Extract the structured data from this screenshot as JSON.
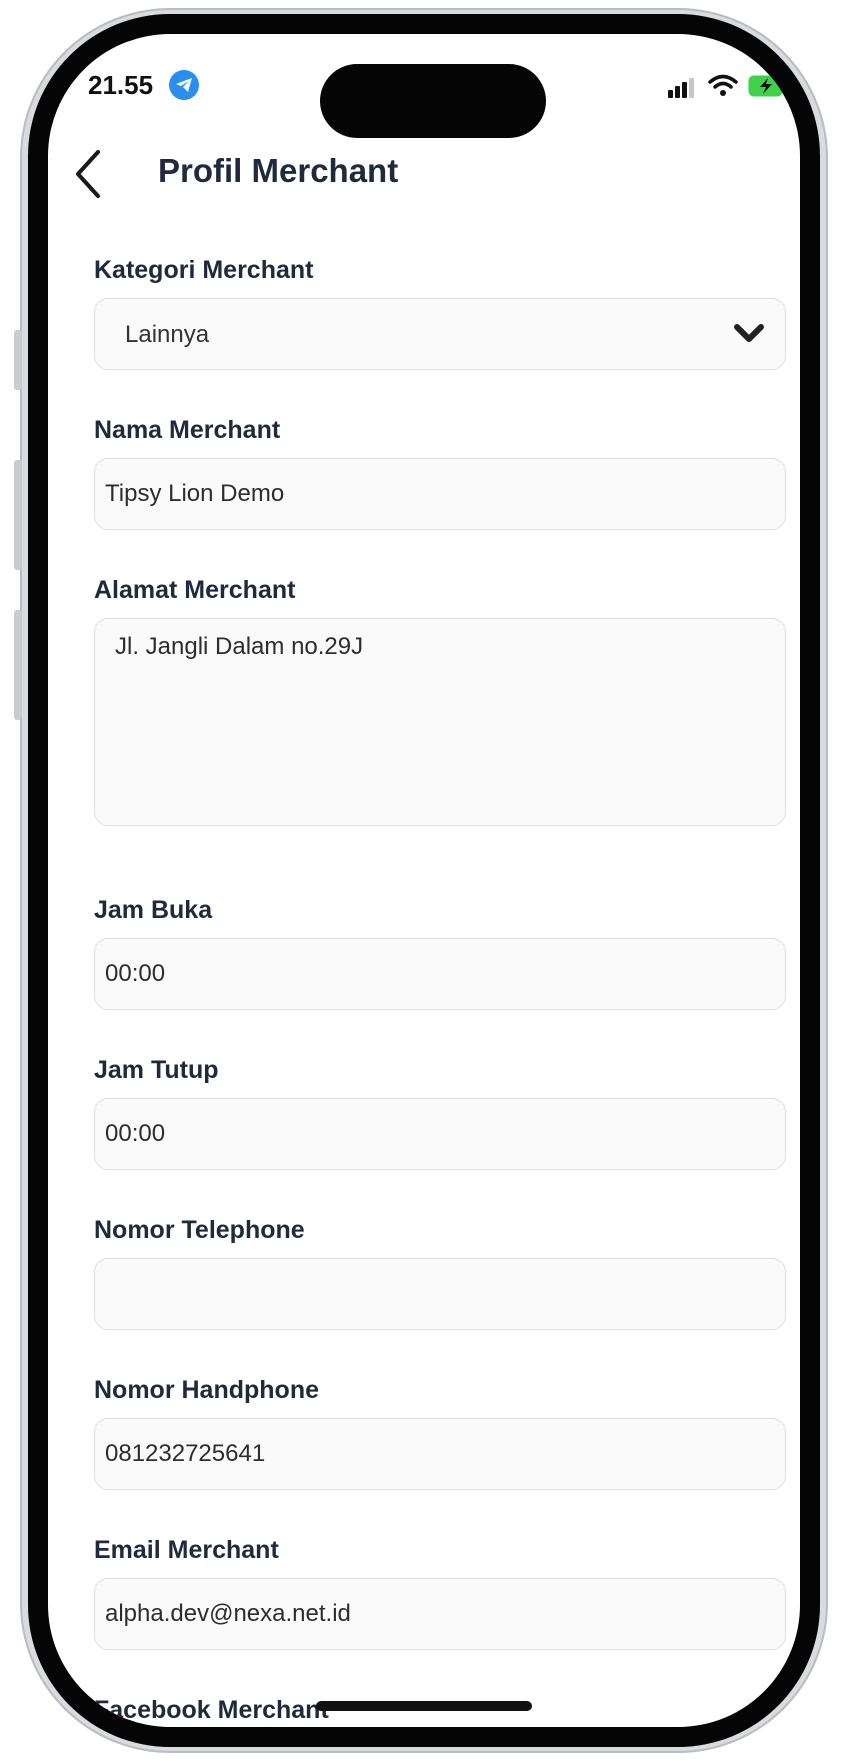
{
  "status_bar": {
    "time": "21.55"
  },
  "header": {
    "title": "Profil Merchant"
  },
  "form": {
    "kategori": {
      "label": "Kategori Merchant",
      "value": "Lainnya"
    },
    "nama": {
      "label": "Nama Merchant",
      "value": "Tipsy Lion Demo"
    },
    "alamat": {
      "label": "Alamat Merchant",
      "value": "Jl. Jangli Dalam no.29J"
    },
    "jam_buka": {
      "label": "Jam Buka",
      "value": "00:00"
    },
    "jam_tutup": {
      "label": "Jam Tutup",
      "value": "00:00"
    },
    "telephone": {
      "label": "Nomor Telephone",
      "value": ""
    },
    "handphone": {
      "label": "Nomor Handphone",
      "value": "081232725641"
    },
    "email": {
      "label": "Email Merchant",
      "value": "alpha.dev@nexa.net.id"
    },
    "facebook": {
      "label": "Facebook Merchant"
    }
  },
  "colors": {
    "label_text": "#1f2a3c",
    "field_border": "#dcdfe3",
    "field_bg": "#fafafa",
    "telegram_blue": "#2a8df0",
    "battery_green": "#3ed14a"
  },
  "icons": [
    "telegram-icon",
    "signal-icon",
    "wifi-icon",
    "battery-icon",
    "back-icon",
    "chevron-down-icon"
  ]
}
